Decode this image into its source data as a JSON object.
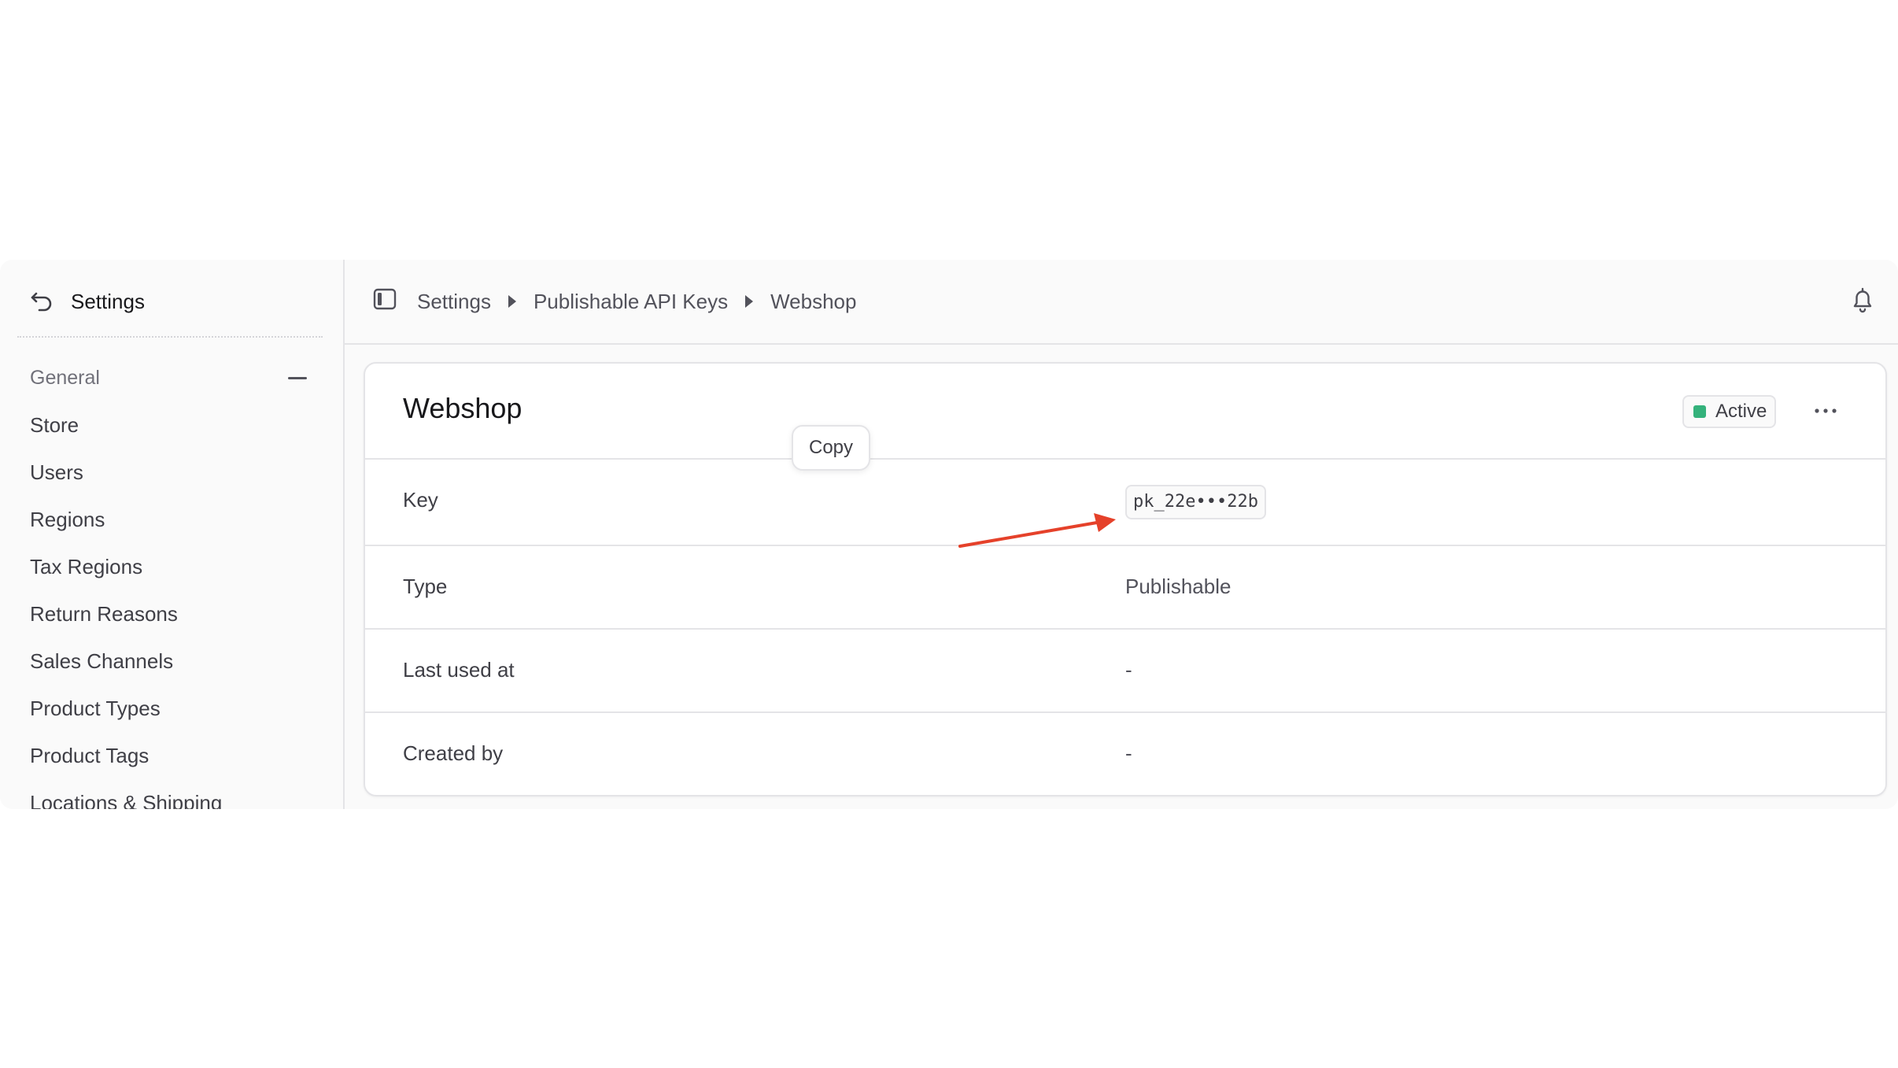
{
  "sidebar": {
    "title": "Settings",
    "section": {
      "label": "General"
    },
    "items": [
      {
        "label": "Store"
      },
      {
        "label": "Users"
      },
      {
        "label": "Regions"
      },
      {
        "label": "Tax Regions"
      },
      {
        "label": "Return Reasons"
      },
      {
        "label": "Sales Channels"
      },
      {
        "label": "Product Types"
      },
      {
        "label": "Product Tags"
      },
      {
        "label": "Locations & Shipping"
      }
    ]
  },
  "breadcrumb": {
    "items": [
      {
        "label": "Settings"
      },
      {
        "label": "Publishable API Keys"
      },
      {
        "label": "Webshop"
      }
    ]
  },
  "card": {
    "title": "Webshop",
    "status": {
      "label": "Active",
      "color": "#34b27b"
    },
    "tooltip": "Copy",
    "rows": {
      "key": {
        "label": "Key",
        "value": "pk_22e•••22b"
      },
      "type": {
        "label": "Type",
        "value": "Publishable"
      },
      "last_used": {
        "label": "Last used at",
        "value": "-"
      },
      "created_by": {
        "label": "Created by",
        "value": "-"
      }
    }
  },
  "annotation": {
    "color": "#e5412a"
  }
}
